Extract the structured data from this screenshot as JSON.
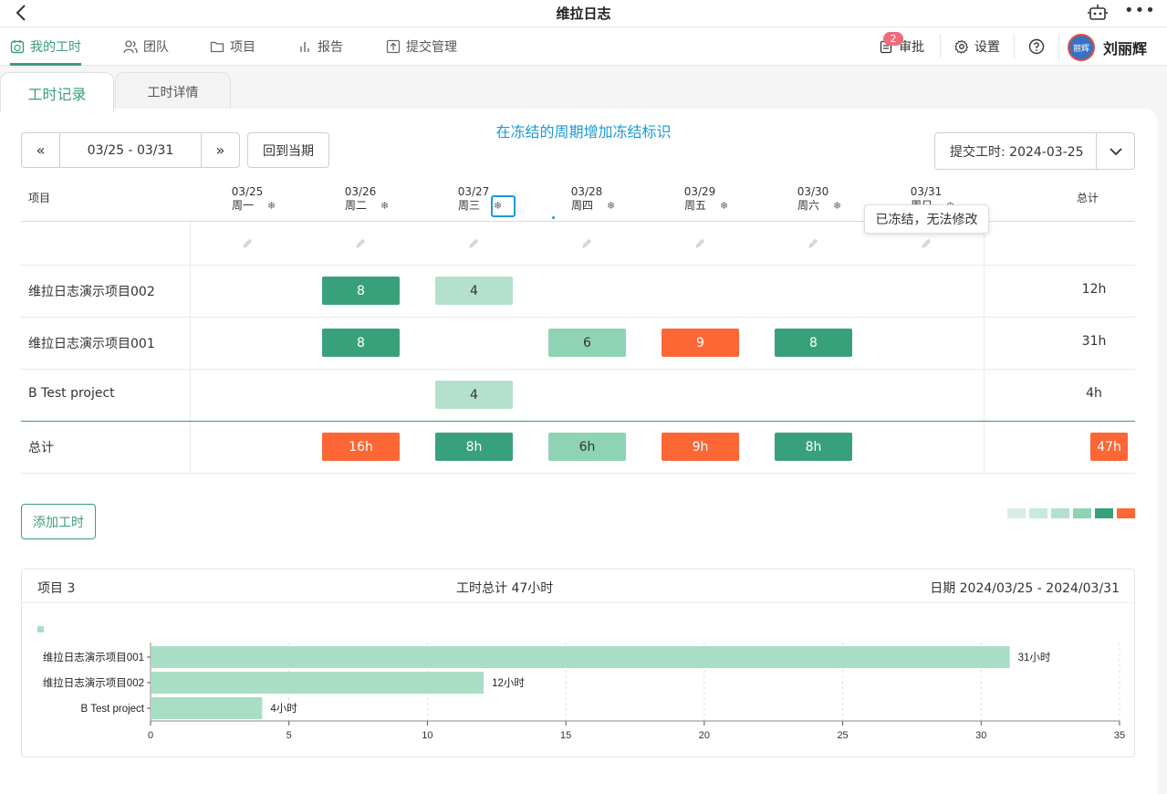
{
  "app": {
    "title": "维拉日志"
  },
  "nav": {
    "items": [
      {
        "label": "我的工时",
        "icon": "calendar-clock-icon",
        "active": true
      },
      {
        "label": "团队",
        "icon": "team-icon"
      },
      {
        "label": "项目",
        "icon": "folder-icon"
      },
      {
        "label": "报告",
        "icon": "bar-chart-icon"
      },
      {
        "label": "提交管理",
        "icon": "upload-icon"
      }
    ],
    "approve": {
      "label": "审批",
      "badge": "2"
    },
    "settings": "设置",
    "help_icon": "help-icon",
    "user": {
      "name": "刘丽辉",
      "avatar_text": "丽辉"
    }
  },
  "tabs": {
    "records": "工时记录",
    "details": "工时详情"
  },
  "annotation": "在冻结的周期增加冻结标识",
  "toolbar": {
    "prev": "«",
    "range": "03/25 - 03/31",
    "next": "»",
    "current": "回到当期",
    "submit": "提交工时: 2024-03-25"
  },
  "table": {
    "project_header": "项目",
    "total_header": "总计",
    "days": [
      {
        "date": "03/25",
        "weekday": "周一"
      },
      {
        "date": "03/26",
        "weekday": "周二"
      },
      {
        "date": "03/27",
        "weekday": "周三"
      },
      {
        "date": "03/28",
        "weekday": "周四"
      },
      {
        "date": "03/29",
        "weekday": "周五"
      },
      {
        "date": "03/30",
        "weekday": "周六"
      },
      {
        "date": "03/31",
        "weekday": "周日"
      }
    ],
    "frozen_icon": "snowflake-icon",
    "tooltip": "已冻结，无法修改",
    "rows": [
      {
        "name": "维拉日志演示项目002",
        "hours": [
          null,
          "8",
          "4",
          null,
          null,
          null,
          null
        ],
        "levels": [
          null,
          "dark",
          "light",
          null,
          null,
          null,
          null
        ],
        "total": "12h"
      },
      {
        "name": "维拉日志演示项目001",
        "hours": [
          null,
          "8",
          null,
          "6",
          "9",
          "8",
          null
        ],
        "levels": [
          null,
          "dark",
          null,
          "mid",
          "red",
          "dark",
          null
        ],
        "total": "31h"
      },
      {
        "name": "B Test project",
        "hours": [
          null,
          null,
          "4",
          null,
          null,
          null,
          null
        ],
        "levels": [
          null,
          null,
          "light",
          null,
          null,
          null,
          null
        ],
        "total": "4h"
      }
    ],
    "totals": {
      "label": "总计",
      "hours": [
        null,
        "16h",
        "8h",
        "6h",
        "9h",
        "8h",
        null
      ],
      "levels": [
        null,
        "red",
        "dark",
        "mid",
        "red",
        "dark",
        null
      ],
      "grand": "47h"
    }
  },
  "add_button": "添加工时",
  "legend_colors": [
    "#d9ece5",
    "#c7eadb",
    "#b3e1cd",
    "#8fd3b5",
    "#38a17b",
    "#fc6735"
  ],
  "summary": {
    "projects": "项目 3",
    "total": "工时总计 47小时",
    "date": "日期 2024/03/25 - 2024/03/31"
  },
  "chart_data": {
    "type": "bar",
    "orientation": "horizontal",
    "categories": [
      "维拉日志演示项目001",
      "维拉日志演示项目002",
      "B Test project"
    ],
    "values": [
      31,
      12,
      4
    ],
    "data_labels": [
      "31小时",
      "12小时",
      "4小时"
    ],
    "xlim": [
      0,
      35
    ],
    "xticks": [
      0,
      5,
      10,
      15,
      20,
      25,
      30,
      35
    ],
    "color": "#a8dec6",
    "grid": true
  }
}
